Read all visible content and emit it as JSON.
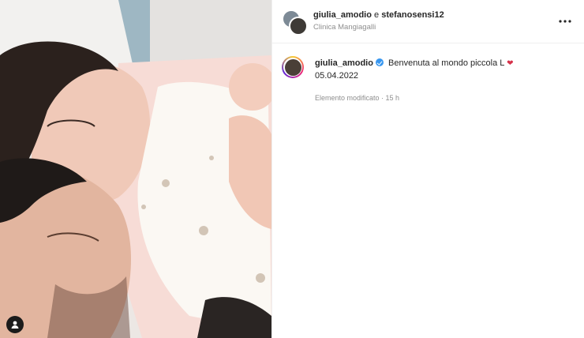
{
  "header": {
    "user1": "giulia_amodio",
    "conjunction": "e",
    "user2": "stefanosensi12",
    "location": "Clinica Mangiagalli",
    "more_icon": "more-horizontal-icon"
  },
  "caption": {
    "username": "giulia_amodio",
    "verified_icon": "verified-badge-icon",
    "text": "Benvenuta al mondo piccola L",
    "emoji": "❤",
    "date": "05.04.2022"
  },
  "meta": {
    "edited_time": "Elemento modificato · 15 h"
  },
  "photo": {
    "tag_icon": "user-tag-icon"
  },
  "colors": {
    "verified": "#3897f0",
    "muted_text": "#8e8e8e",
    "heart": "#d6334b"
  }
}
